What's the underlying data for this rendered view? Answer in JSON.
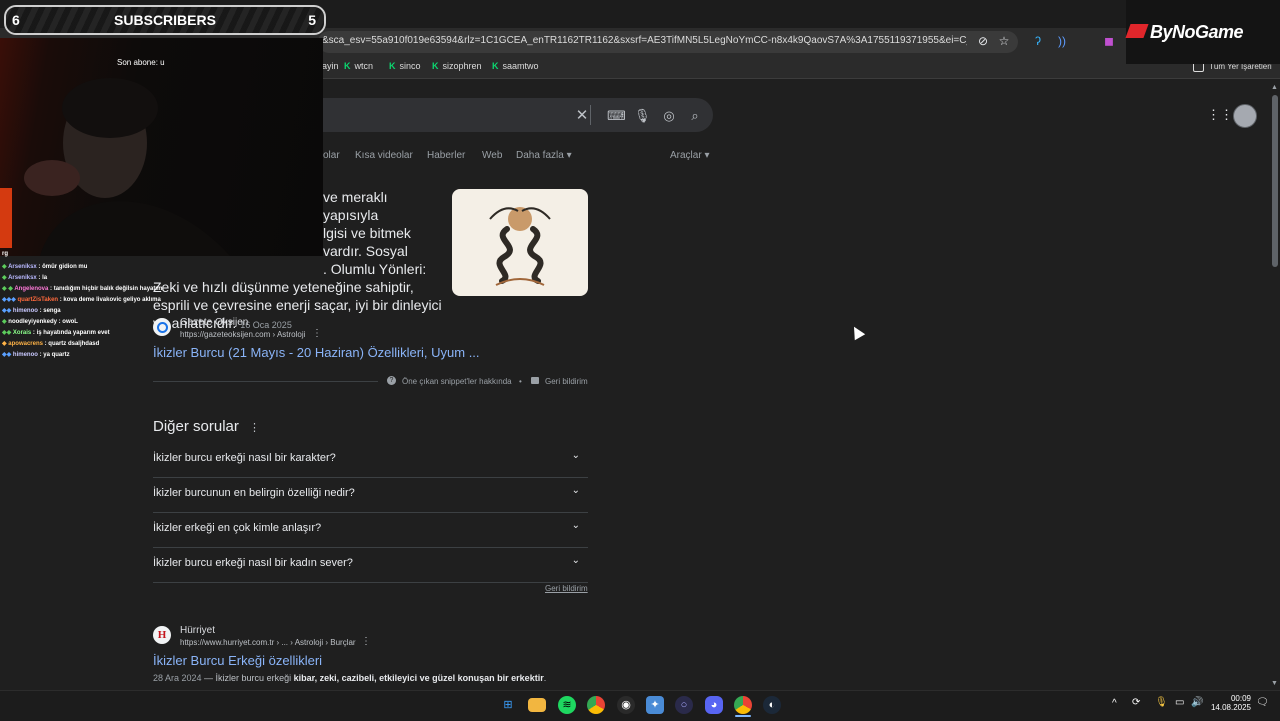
{
  "browser": {
    "url": "&sca_esv=55a910f019e63594&rlz=1C1GCEA_enTR1162TR1162&sxsrf=AE3TifMN5L5LegNoYmCC-n8x4k9QaovS7A%3A1755119371955&ei=C_-caMX_OaW...",
    "bookmarks": [
      {
        "label": "ayin",
        "icon": ""
      },
      {
        "label": "wtcn",
        "icon": "K"
      },
      {
        "label": "sinco",
        "icon": "K"
      },
      {
        "label": "sizophren",
        "icon": "K"
      },
      {
        "label": "saamtwo",
        "icon": "K"
      }
    ],
    "all_bookmarks": "Tüm Yer İşaretleri"
  },
  "search": {
    "tabs": [
      "olar",
      "Kısa videolar",
      "Haberler",
      "Web",
      "Daha fazla",
      "Araçlar"
    ]
  },
  "snippet": {
    "lines": [
      "ve meraklı yapısıyla",
      "lgisi ve bitmek",
      "vardır. Sosyal",
      ". Olumlu Yönleri:",
      "Zeki ve hızlı düşünme yeteneğine sahiptir,",
      "esprili ve çevresine enerji saçar, iyi bir dinleyici",
      "ve anlatıcıdır."
    ],
    "date": "16 Oca 2025",
    "source_name": "Gazete Oksijen",
    "source_url": "https://gazeteoksijen.com › Astroloji",
    "result_title": "İkizler Burcu (21 Mayıs - 20 Haziran) Özellikleri, Uyum ...",
    "about": "Öne çıkan snippet'ler hakkında",
    "feedback": "Geri bildirim"
  },
  "paa": {
    "title": "Diğer sorular",
    "questions": [
      "İkizler burcu erkeği nasıl bir karakter?",
      "İkizler burcunun en belirgin özelliği nedir?",
      "İkizler erkeği en çok kimle anlaşır?",
      "İkizler burcu erkeği nasıl bir kadın sever?"
    ],
    "feedback": "Geri bildirim"
  },
  "result2": {
    "source_name": "Hürriyet",
    "favicon": "H",
    "source_url": "https://www.hurriyet.com.tr › ... › Astroloji › Burçlar",
    "title": "İkizler Burcu Erkeği özellikleri",
    "date": "28 Ara 2024",
    "snippet_plain": " — İkizler burcu erkeği ",
    "snippet_bold": "kibar, zeki, cazibeli, etkileyici ve güzel konuşan bir erkektir",
    "snippet_end": "."
  },
  "overlay": {
    "sub_left": "6",
    "sub_label": "SUBSCRIBERS",
    "sub_right": "5",
    "last_sub": "Son abone: u",
    "logo": "ByNoGame",
    "chat": [
      {
        "user": "",
        "msg": "rg",
        "color": "#d4d4d4"
      },
      {
        "user": "Arseniksx",
        "msg": " : ömür gidion mu",
        "color": "#b9b9ff"
      },
      {
        "user": "Arseniksx",
        "msg": " : la",
        "color": "#b9b9ff"
      },
      {
        "user": "Angelenova",
        "msg": " : tanıdığım hiçbir balık değilsin hayatım",
        "color": "#ff7ad9"
      },
      {
        "user": "quartZisTaken",
        "msg": " : kova deme livakovic geliyo aklıma",
        "color": "#ff6a3d"
      },
      {
        "user": "himenoo",
        "msg": " : senga",
        "color": "#c9c9ff"
      },
      {
        "user": "noodleyiyenkedy",
        "msg": " : owoL",
        "color": "#ffffff"
      },
      {
        "user": "Xorais",
        "msg": " : iş hayatında yaparım evet",
        "color": "#8cff8c"
      },
      {
        "user": "apowacrens",
        "msg": " : quartz dsaljhdasd",
        "color": "#ffb347"
      },
      {
        "user": "himenoo",
        "msg": " : ya quartz",
        "color": "#c9c9ff"
      }
    ]
  },
  "taskbar": {
    "time": "00:09",
    "date": "14.08.2025"
  },
  "colors": {
    "link": "#8ab4f8",
    "bg": "#1f1f1f",
    "accent": "#0bd66f"
  }
}
